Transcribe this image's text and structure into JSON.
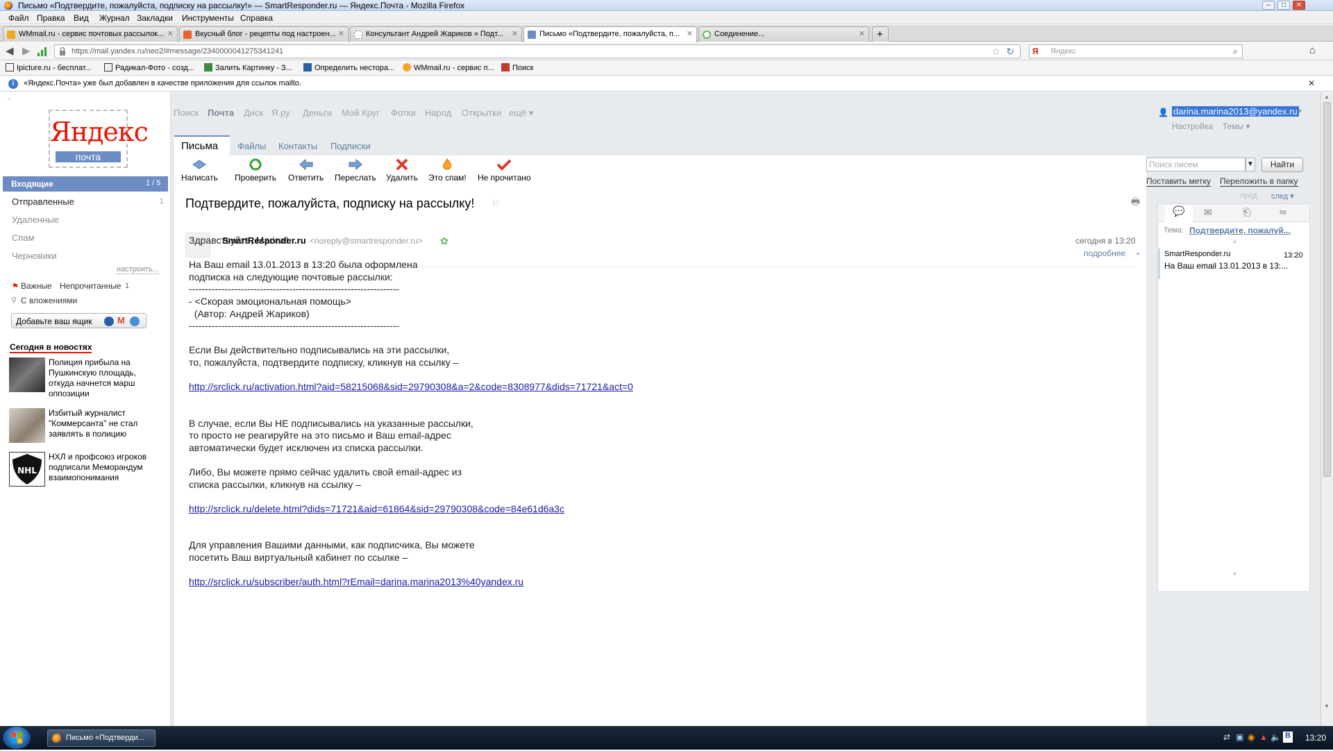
{
  "window": {
    "title": "Письмо «Подтвердите, пожалуйста, подписку на рассылку!» — SmartResponder.ru — Яндекс.Почта - Mozilla Firefox"
  },
  "menubar": [
    "Файл",
    "Правка",
    "Вид",
    "Журнал",
    "Закладки",
    "Инструменты",
    "Справка"
  ],
  "tabs": [
    {
      "label": "WMmail.ru - сервис почтовых рассылок...",
      "color": "#f5a623"
    },
    {
      "label": "Вкусный блог - рецепты под настроен...",
      "color": "#e8632b"
    },
    {
      "label": "Консультант Андрей Жариков » Подт...",
      "color": "#cfcfcf"
    },
    {
      "label": "Письмо «Подтвердите, пожалуйста, п...",
      "color": "#6c8cc4"
    },
    {
      "label": "Соединение...",
      "color": "#5cb85c"
    }
  ],
  "nav": {
    "url": "https://mail.yandex.ru/neo2/#message/2340000041275341241",
    "search_placeholder": "Яндекс"
  },
  "bookmarks": [
    "Ipicture.ru - бесплат...",
    "Радикал-Фото - созд...",
    "Залить Картинку - З...",
    "Определить нестора...",
    "WMmail.ru - сервис п...",
    "Поиск"
  ],
  "notification": "«Яндекс.Почта» уже был добавлен в качестве приложения для ссылок mailto.",
  "yandex": {
    "logo": "Яндекс",
    "logo_sub": "почта",
    "topnav": [
      "Поиск",
      "Почта",
      "Диск",
      "Я.ру",
      "Деньги",
      "Мой Круг",
      "Фотки",
      "Народ",
      "Открытки",
      "ещё ▾"
    ],
    "user_email": "darina.marina2013@yandex.ru",
    "settings": "Настройка",
    "themes": "Темы ▾",
    "subnav": [
      "Письма",
      "Файлы",
      "Контакты",
      "Подписки"
    ]
  },
  "folders": {
    "inbox": "Входящие",
    "inbox_count": "1 / 5",
    "sent": "Отправленные",
    "sent_count": "1",
    "deleted": "Удаленные",
    "spam": "Спам",
    "drafts": "Черновики",
    "configure": "настроить...",
    "important": "Важные",
    "unread": "Непрочитанные",
    "unread_count": "1",
    "attachments": "С вложениями",
    "add_box": "Добавьте ваш ящик"
  },
  "news": {
    "heading": "Сегодня в новостях",
    "items": [
      "Полиция прибыла на Пушкинскую площадь, откуда начнется марш оппозиции",
      "Избитый журналист \"Коммерсанта\" не стал заявлять в полицию",
      "НХЛ и профсоюз игроков подписали Меморандум взаимопонимания"
    ]
  },
  "toolbar": [
    "Написать",
    "Проверить",
    "Ответить",
    "Переслать",
    "Удалить",
    "Это спам!",
    "Не прочитано"
  ],
  "search": {
    "placeholder": "Поиск писем",
    "button": "Найти",
    "put_label": "Поставить метку",
    "move_folder": "Переложить в папку",
    "prev": "пред",
    "next": "след ▾"
  },
  "message": {
    "subject": "Подтвердите, пожалуйста, подписку на рассылку!",
    "sender": "SmartResponder.ru",
    "sender_email": "<noreply@smartresponder.ru>",
    "date": "сегодня в 13:20",
    "details": "подробнее",
    "body": [
      "Здравствуйте, Marina!",
      "",
      "На Ваш email 13.01.2013 в 13:20 была оформлена",
      "подписка на следующие почтовые рассылки:",
      "-----------------------------------------------------------------",
      "- <Скорая эмоциональная помощь>",
      "  (Автор: Андрей Жариков)",
      "-----------------------------------------------------------------",
      "",
      "Если Вы действительно подписывались на эти рассылки,",
      "то, пожалуйста, подтвердите подписку, кликнув на ссылку –"
    ],
    "link1": "http://srclick.ru/activation.html?aid=58215068&sid=29790308&a=2&code=8308977&dids=71721&act=0",
    "body2": [
      "В случае, если Вы НЕ подписывались на указанные рассылки,",
      "то просто не реагируйте на это письмо и Ваш email-адрес",
      "автоматически будет исключен из списка рассылки.",
      "",
      "Либо, Вы можете прямо сейчас удалить свой email-адрес из",
      "списка рассылки, кликнув на ссылку –"
    ],
    "link2": "http://srclick.ru/delete.html?dids=71721&aid=61864&sid=29790308&code=84e61d6a3c",
    "body3": [
      "Для управления Вашими данными, как подписчика, Вы можете",
      "посетить Ваш виртуальный кабинет по ссылке –"
    ],
    "link3": "http://srclick.ru/subscriber/auth.html?rEmail=darina.marina2013%40yandex.ru"
  },
  "thread": {
    "topic_label": "Тема:",
    "topic": "Подтвердите, пожалуй...",
    "from": "SmartResponder.ru",
    "time": "13:20",
    "preview": "На Ваш email 13.01.2013 в 13:..."
  },
  "taskbar": {
    "task": "Письмо «Подтверди...",
    "clock": "13:20"
  }
}
